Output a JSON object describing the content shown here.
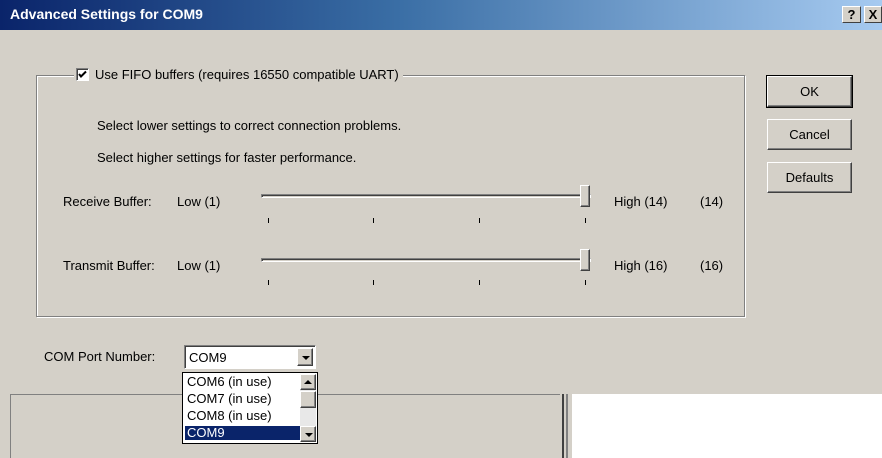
{
  "window": {
    "title": "Advanced Settings for COM9",
    "help_label": "?",
    "close_label": "X"
  },
  "fifo": {
    "checked": true,
    "label": "Use FIFO buffers (requires 16550 compatible UART)",
    "hint_lower": "Select lower settings to correct connection problems.",
    "hint_higher": "Select higher settings for faster performance."
  },
  "receive": {
    "label": "Receive Buffer:",
    "low_label": "Low (1)",
    "high_label": "High (14)",
    "value_label": "(14)",
    "level": 1.0
  },
  "transmit": {
    "label": "Transmit Buffer:",
    "low_label": "Low (1)",
    "high_label": "High (16)",
    "value_label": "(16)",
    "level": 1.0
  },
  "buttons": {
    "ok": "OK",
    "cancel": "Cancel",
    "defaults": "Defaults"
  },
  "com_port": {
    "label": "COM Port Number:",
    "selected": "COM9",
    "options": [
      "COM6 (in use)",
      "COM7 (in use)",
      "COM8 (in use)",
      "COM9"
    ]
  },
  "colors": {
    "titlebar_start": "#0a246a",
    "titlebar_end": "#a6caf0",
    "dialog_bg": "#d4d0c8",
    "selection": "#0a246a"
  }
}
